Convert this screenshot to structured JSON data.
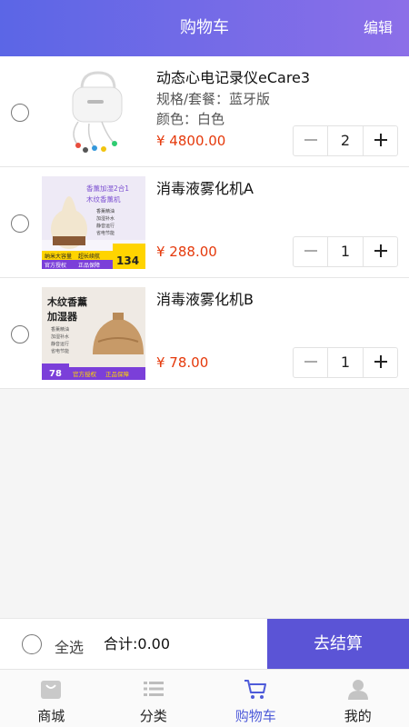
{
  "header": {
    "title": "购物车",
    "edit_label": "编辑"
  },
  "items": [
    {
      "name": "动态心电记录仪eCare3",
      "spec1": "规格/套餐：蓝牙版",
      "spec2": "颜色：白色",
      "price": "¥ 4800.00",
      "qty": "2"
    },
    {
      "name": "消毒液雾化机A",
      "price": "¥ 288.00",
      "qty": "1",
      "thumb_texts": {
        "title1": "香薰加湿2合1",
        "title2": "木纹香薰机",
        "f1": "香薰精油",
        "f2": "加湿补水",
        "f3": "静音运行",
        "f4": "省电节能",
        "band1": "纳米大容量",
        "band2": "超长续航",
        "band3": "官方授权",
        "band4": "正品保障",
        "price_tag": "134"
      }
    },
    {
      "name": "消毒液雾化机B",
      "price": "¥ 78.00",
      "qty": "1",
      "thumb_texts": {
        "title1": "木纹香薰",
        "title2": "加湿器",
        "f1": "香薰精油",
        "f2": "加湿补水",
        "f3": "静音运行",
        "f4": "省电节能",
        "band1": "官方授权",
        "band2": "正品保障",
        "price_tag": "78"
      }
    }
  ],
  "footer": {
    "select_all_label": "全选",
    "total_label": "合计:0.00",
    "checkout_label": "去结算"
  },
  "tabs": [
    {
      "label": "商城",
      "icon": "bag-icon"
    },
    {
      "label": "分类",
      "icon": "list-icon"
    },
    {
      "label": "购物车",
      "icon": "cart-icon",
      "active": true
    },
    {
      "label": "我的",
      "icon": "user-icon"
    }
  ],
  "colors": {
    "header_start": "#5b66e6",
    "header_end": "#8c6fe8",
    "price": "#e5390b",
    "checkout_bg": "#5b54d6",
    "active_tab": "#4e5bd9"
  }
}
